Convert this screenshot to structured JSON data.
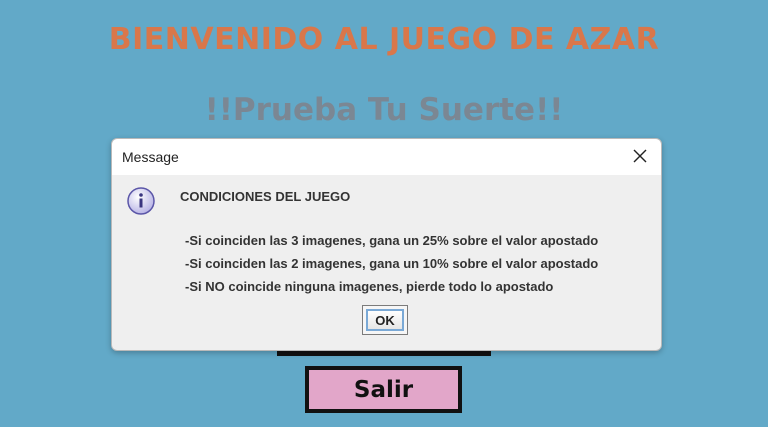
{
  "app": {
    "title": "BIENVENIDO AL JUEGO DE AZAR",
    "subtitle": "!!Prueba Tu Suerte!!",
    "exit_label": "Salir"
  },
  "dialog": {
    "window_title": "Message",
    "icon": "info-icon",
    "heading": "CONDICIONES DEL JUEGO",
    "rules": [
      "-Si coinciden las 3 imagenes, gana un 25% sobre el valor apostado",
      "-Si coinciden las 2 imagenes, gana un 10% sobre el valor apostado",
      "-Si NO coincide ninguna imagenes, pierde todo lo apostado"
    ],
    "ok_label": "OK"
  },
  "colors": {
    "background": "#62a9c8",
    "title": "#d9774a",
    "subtitle": "#7b8793",
    "exit_button": "#e2a6c9"
  }
}
